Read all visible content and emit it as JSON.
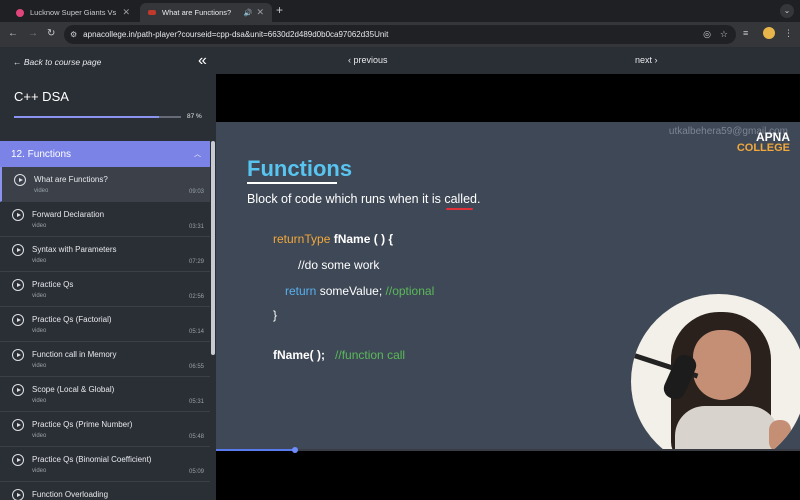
{
  "browser": {
    "tabs": [
      {
        "title": "Lucknow Super Giants Vs Mu",
        "favicon_color": "#e0457b"
      },
      {
        "title": "What are Functions?",
        "favicon_color": "#c0392b",
        "active": true
      }
    ],
    "url": "apnacollege.in/path-player?courseid=cpp-dsa&unit=6630d2d489d0b0ca97062d35Unit"
  },
  "sidebar": {
    "back_label": "Back to course page",
    "course_title": "C++ DSA",
    "progress_percent": 87,
    "progress_label": "87 %",
    "section_title": "12. Functions",
    "lessons": [
      {
        "title": "What are Functions?",
        "type": "video",
        "duration": "09:03",
        "active": true
      },
      {
        "title": "Forward Declaration",
        "type": "video",
        "duration": "03:31"
      },
      {
        "title": "Syntax with Parameters",
        "type": "video",
        "duration": "07:29"
      },
      {
        "title": "Practice Qs",
        "type": "video",
        "duration": "02:56"
      },
      {
        "title": "Practice Qs (Factorial)",
        "type": "video",
        "duration": "05:14"
      },
      {
        "title": "Function call in Memory",
        "type": "video",
        "duration": "06:55"
      },
      {
        "title": "Scope (Local & Global)",
        "type": "video",
        "duration": "05:31"
      },
      {
        "title": "Practice Qs (Prime Number)",
        "type": "video",
        "duration": "05:48"
      },
      {
        "title": "Practice Qs (Binomial Coefficient)",
        "type": "video",
        "duration": "05:09"
      },
      {
        "title": "Function Overloading",
        "type": "video",
        "duration": ""
      }
    ]
  },
  "player": {
    "previous_label": "previous",
    "next_label": "next",
    "seek_progress_percent": 13.5,
    "slide": {
      "watermark": "utkalbehera59@gmail.com",
      "brand_line1": "APNA",
      "brand_line2": "COLLEGE",
      "title": "Functions",
      "subtitle": "Block of code which runs when it is called.",
      "code": {
        "l1_type": "returnType",
        "l1_name": "fName",
        "l1_rest": "( ) {",
        "l2": "//do some work",
        "l3_kw": "return",
        "l3_val": "someValue;",
        "l3_comment": "//optional",
        "l4": "}",
        "l5_call": "fName( );",
        "l5_comment": "//function call"
      }
    }
  }
}
